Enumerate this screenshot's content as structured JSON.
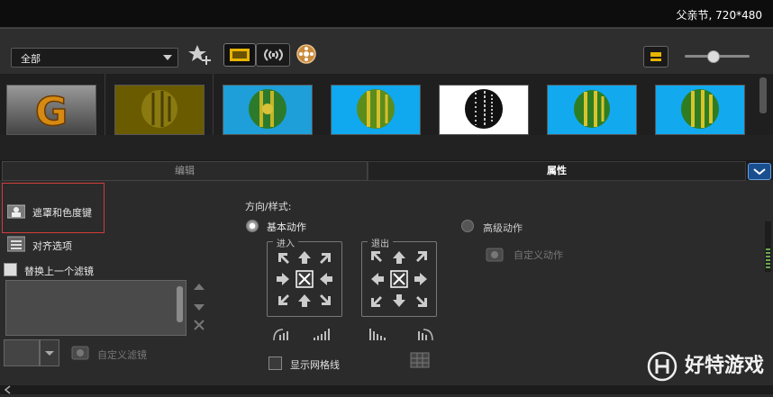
{
  "title": "父亲节, 720*480",
  "toolbar": {
    "category": "全部"
  },
  "tabs": {
    "edit": "编辑",
    "props": "属性"
  },
  "left": {
    "mask": "遮罩和色度键",
    "align": "对齐选项",
    "replace": "替换上一个滤镜",
    "custom_filter": "自定义滤镜"
  },
  "right": {
    "direction_label": "方向/样式:",
    "basic_motion": "基本动作",
    "advanced_motion": "高级动作",
    "custom_motion": "自定义动作",
    "enter": "进入",
    "exit": "退出",
    "show_grid": "显示网格线"
  },
  "watermark": "好特游戏",
  "colors": {
    "accent_blue": "#2a86c9",
    "highlight_red": "#d23b3b",
    "active_toolbar": "#e8b400"
  }
}
